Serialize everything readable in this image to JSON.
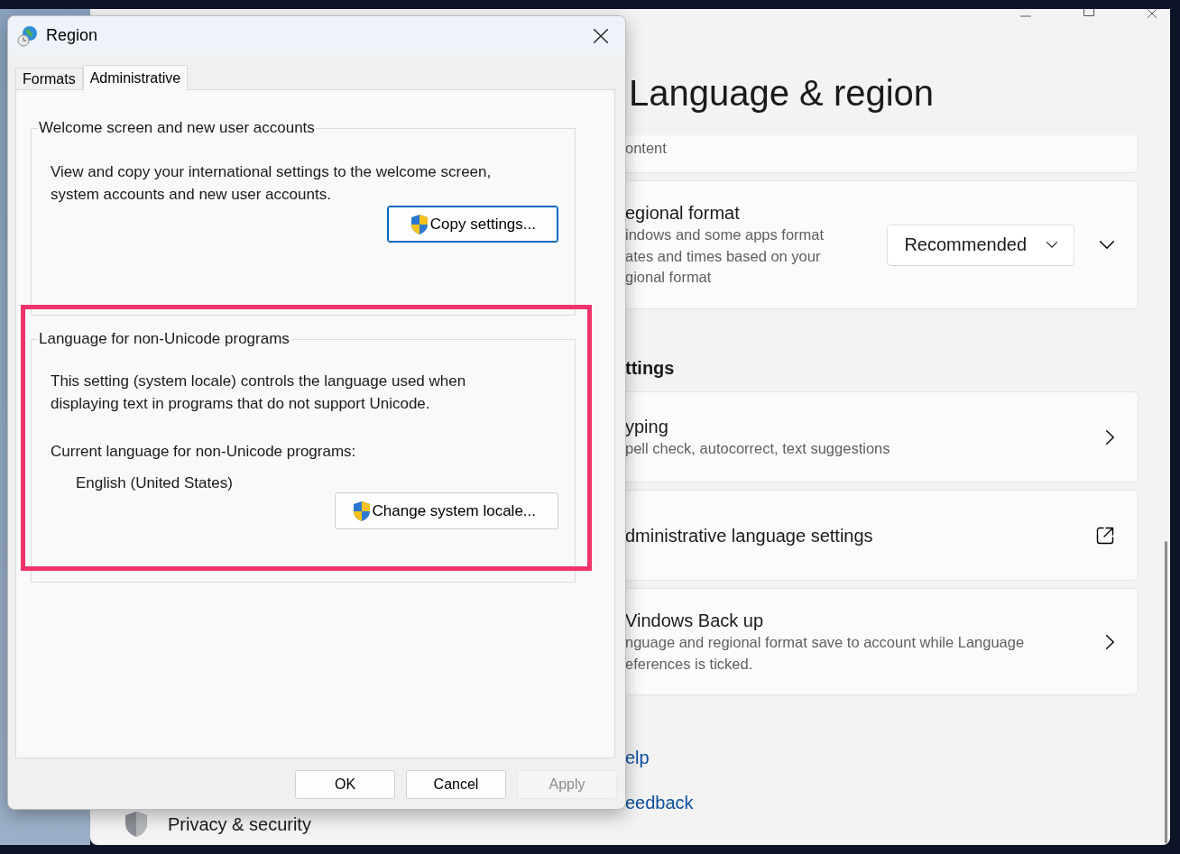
{
  "dialog": {
    "title": "Region",
    "tabs": [
      {
        "label": "Formats",
        "selected": false
      },
      {
        "label": "Administrative",
        "selected": true
      }
    ],
    "groups": [
      {
        "title": "Welcome screen and new user accounts",
        "description": "View and copy your international settings to the welcome screen, system accounts and new user accounts.",
        "button": {
          "label": "Copy settings...",
          "default": true
        }
      },
      {
        "title": "Language for non-Unicode programs",
        "description": "This setting (system locale) controls the language used when displaying text in programs that do not support Unicode.",
        "current_label": "Current language for non-Unicode programs:",
        "current_value": "English (United States)",
        "button": {
          "label": "Change system locale...",
          "default": false
        }
      }
    ],
    "buttons": [
      {
        "label": "OK",
        "disabled": false
      },
      {
        "label": "Cancel",
        "disabled": false
      },
      {
        "label": "Apply",
        "disabled": true
      }
    ]
  },
  "settings": {
    "title": "Language & region",
    "sidebar_item": "Privacy & security",
    "sections": [
      {
        "cards": [
          {
            "kind": "partial",
            "description": [
              "ontent"
            ]
          },
          {
            "kind": "dropdown",
            "title": "egional format",
            "description": [
              "indows and some apps format",
              "ates and times based on your",
              "gional format"
            ],
            "value": "Recommended"
          }
        ]
      },
      {
        "heading": "ttings",
        "cards": [
          {
            "kind": "chevron",
            "title": "yping",
            "description": [
              "pell check, autocorrect, text suggestions"
            ]
          },
          {
            "kind": "external",
            "title": "dministrative language settings"
          },
          {
            "kind": "chevron",
            "title": "Vindows Back up",
            "description": [
              "nguage and regional format save to account while Language",
              "eferences is ticked."
            ]
          }
        ]
      }
    ],
    "links": [
      "elp",
      "eedback"
    ]
  }
}
